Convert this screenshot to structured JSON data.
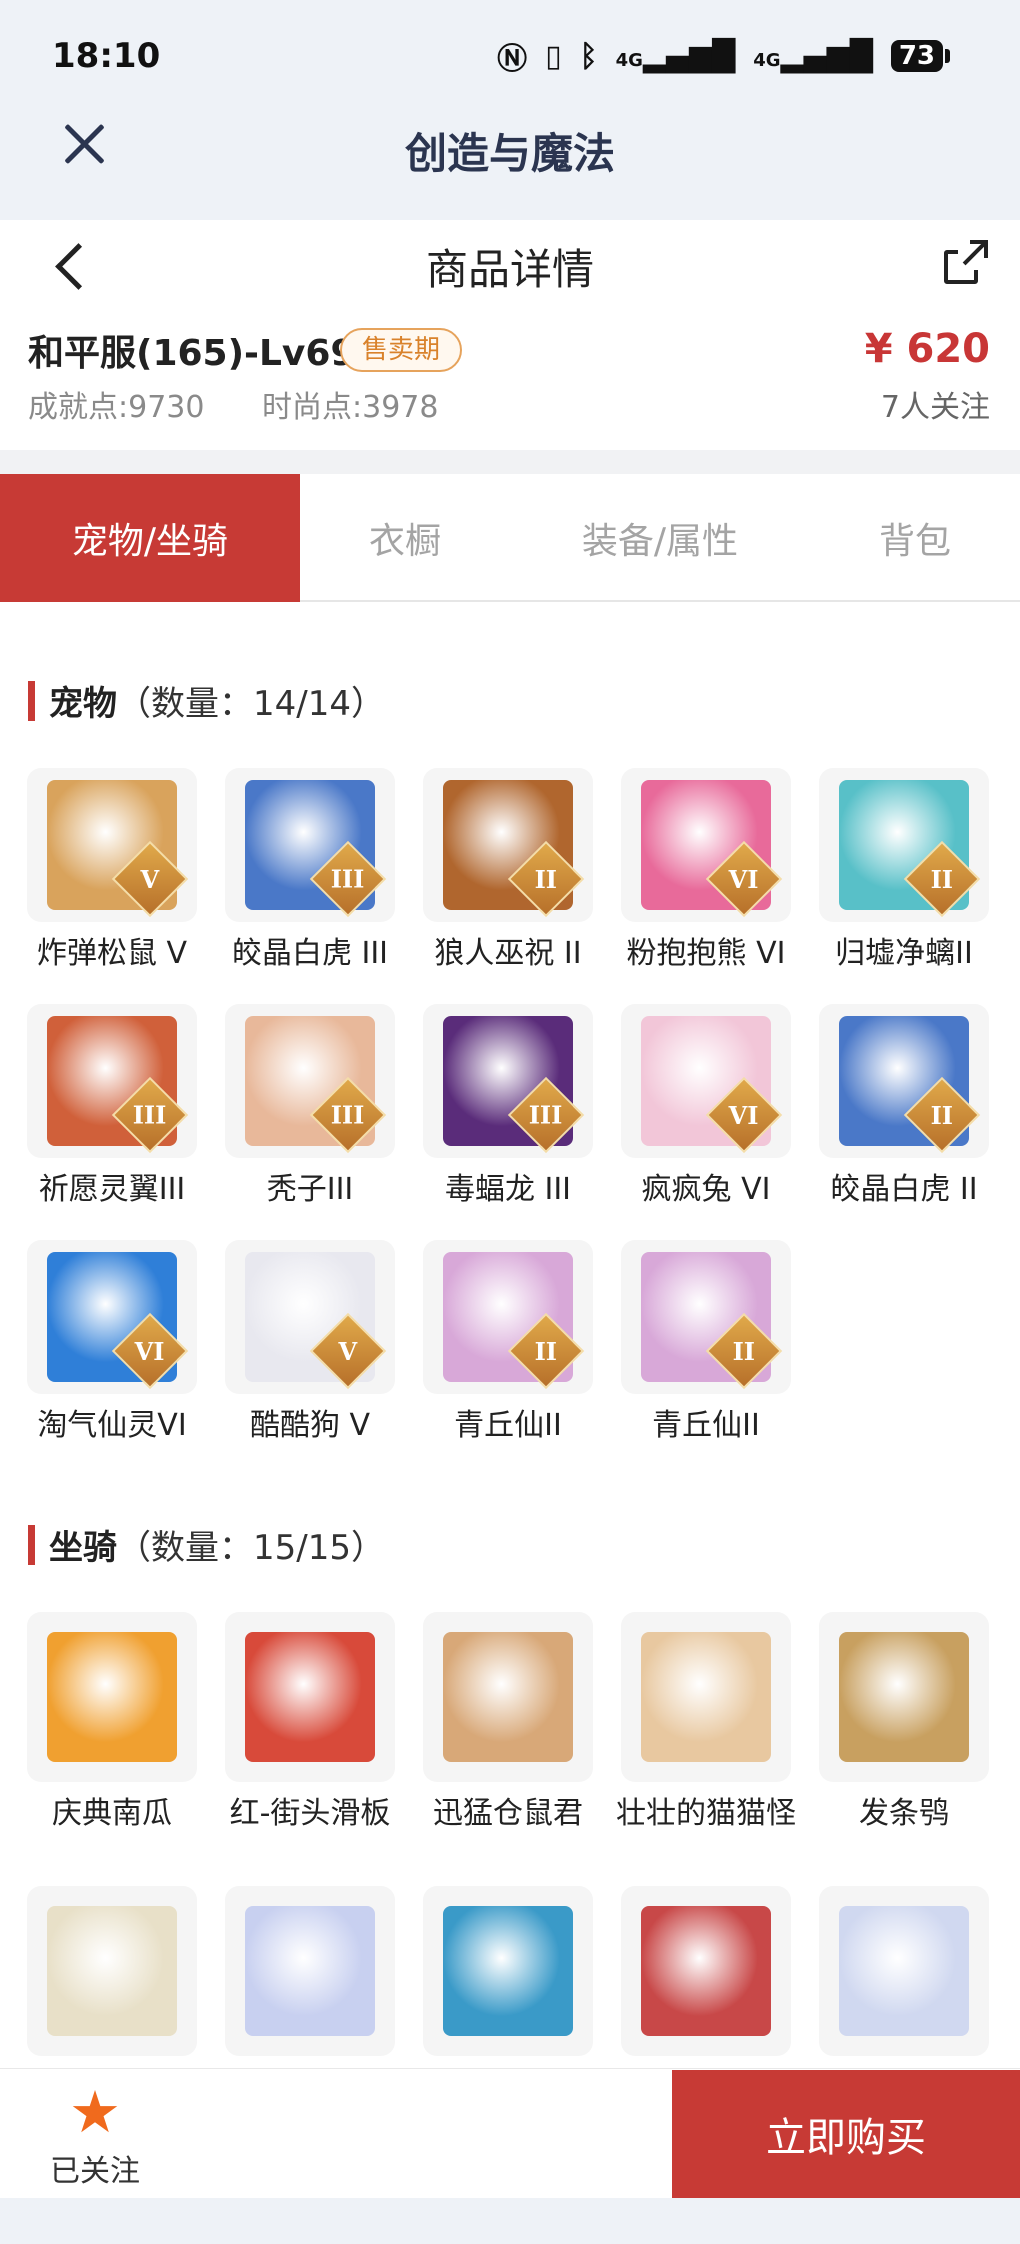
{
  "status_bar": {
    "time": "18:10",
    "network1": "4G",
    "network2": "4G",
    "battery": "73"
  },
  "app": {
    "title": "创造与魔法"
  },
  "page": {
    "title": "商品详情"
  },
  "item": {
    "title": "和平服(165)-Lv69",
    "badge": "售卖期",
    "achievement": "成就点:9730",
    "fashion": "时尚点:3978",
    "price": "¥ 620",
    "followers": "7人关注"
  },
  "tabs": [
    {
      "label": "宠物/坐骑",
      "active": true
    },
    {
      "label": "衣橱",
      "active": false
    },
    {
      "label": "装备/属性",
      "active": false
    },
    {
      "label": "背包",
      "active": false
    }
  ],
  "pets": {
    "title": "宠物",
    "count": "（数量：14/14）",
    "items": [
      {
        "name": "炸弹松鼠 V",
        "tier": "V",
        "color": "#d9a35c"
      },
      {
        "name": "皎晶白虎 III",
        "tier": "III",
        "color": "#4a78c8"
      },
      {
        "name": "狼人巫祝 II",
        "tier": "II",
        "color": "#b0662e"
      },
      {
        "name": "粉抱抱熊 VI",
        "tier": "VI",
        "color": "#e86a9a"
      },
      {
        "name": "归墟净螭II",
        "tier": "II",
        "color": "#58c0c8"
      },
      {
        "name": "祈愿灵翼III",
        "tier": "III",
        "color": "#d0603a"
      },
      {
        "name": "秃子III",
        "tier": "III",
        "color": "#e8b89a"
      },
      {
        "name": "毒蝠龙 III",
        "tier": "III",
        "color": "#5a2c7a"
      },
      {
        "name": "疯疯兔 VI",
        "tier": "VI",
        "color": "#f2c6d8"
      },
      {
        "name": "皎晶白虎 II",
        "tier": "II",
        "color": "#4a78c8"
      },
      {
        "name": "淘气仙灵VI",
        "tier": "VI",
        "color": "#2f7fd8"
      },
      {
        "name": "酷酷狗 V",
        "tier": "V",
        "color": "#e8e8ef"
      },
      {
        "name": "青丘仙II",
        "tier": "II",
        "color": "#d8a8d8"
      },
      {
        "name": "青丘仙II",
        "tier": "II",
        "color": "#d8a8d8"
      }
    ]
  },
  "mounts": {
    "title": "坐骑",
    "count": "（数量：15/15）",
    "items": [
      {
        "name": "庆典南瓜",
        "color": "#f0a030"
      },
      {
        "name": "红-街头滑板",
        "color": "#d84a3a"
      },
      {
        "name": "迅猛仓鼠君",
        "color": "#d8a878"
      },
      {
        "name": "壮壮的猫猫怪",
        "color": "#e8c8a0"
      },
      {
        "name": "发条鸮",
        "color": "#c8a060"
      },
      {
        "name": "",
        "color": "#e8e0c8"
      },
      {
        "name": "",
        "color": "#c8d0f0"
      },
      {
        "name": "",
        "color": "#3a9ac8"
      },
      {
        "name": "",
        "color": "#c84848"
      },
      {
        "name": "",
        "color": "#d0d8f0"
      }
    ]
  },
  "bottom": {
    "follow_label": "已关注",
    "buy_label": "立即购买"
  }
}
